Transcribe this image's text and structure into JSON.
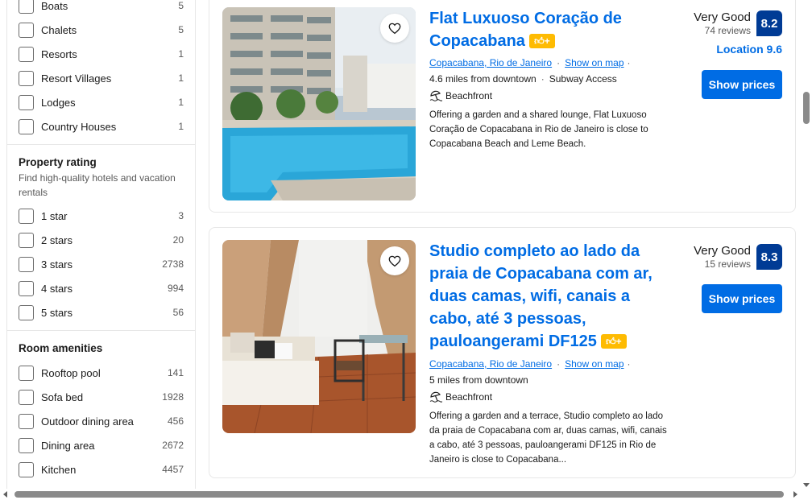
{
  "filters": {
    "property_type": [
      {
        "label": "Boats",
        "count": "5"
      },
      {
        "label": "Chalets",
        "count": "5"
      },
      {
        "label": "Resorts",
        "count": "1"
      },
      {
        "label": "Resort Villages",
        "count": "1"
      },
      {
        "label": "Lodges",
        "count": "1"
      },
      {
        "label": "Country Houses",
        "count": "1"
      }
    ],
    "property_rating": {
      "heading": "Property rating",
      "subtitle": "Find high-quality hotels and vacation rentals",
      "items": [
        {
          "label": "1 star",
          "count": "3"
        },
        {
          "label": "2 stars",
          "count": "20"
        },
        {
          "label": "3 stars",
          "count": "2738"
        },
        {
          "label": "4 stars",
          "count": "994"
        },
        {
          "label": "5 stars",
          "count": "56"
        }
      ]
    },
    "room_amenities": {
      "heading": "Room amenities",
      "items": [
        {
          "label": "Rooftop pool",
          "count": "141"
        },
        {
          "label": "Sofa bed",
          "count": "1928"
        },
        {
          "label": "Outdoor dining area",
          "count": "456"
        },
        {
          "label": "Dining area",
          "count": "2672"
        },
        {
          "label": "Kitchen",
          "count": "4457"
        }
      ]
    }
  },
  "listings": [
    {
      "title": "Flat Luxuoso Coração de Copacabana",
      "location": "Copacabana, Rio de Janeiro",
      "show_on_map": "Show on map",
      "distance": "4.6 miles from downtown",
      "transit": "Subway Access",
      "amenity": "Beachfront",
      "description": "Offering a garden and a shared lounge, Flat Luxuoso Coração de Copacabana in Rio de Janeiro is close to Copacabana Beach and Leme Beach.",
      "review_word": "Very Good",
      "review_count": "74 reviews",
      "score": "8.2",
      "location_score": "Location 9.6",
      "button": "Show prices"
    },
    {
      "title": "Studio completo ao lado da praia de Copacabana com ar, duas camas, wifi, canais a cabo, até 3 pessoas, pauloangerami DF125",
      "location": "Copacabana, Rio de Janeiro",
      "show_on_map": "Show on map",
      "distance": "5 miles from downtown",
      "amenity": "Beachfront",
      "description": "Offering a garden and a terrace, Studio completo ao lado da praia de Copacabana com ar, duas camas, wifi, canais a cabo, até 3 pessoas, pauloangerami DF125 in Rio de Janeiro is close to Copacabana...",
      "review_word": "Very Good",
      "review_count": "15 reviews",
      "score": "8.3",
      "button": "Show prices"
    }
  ],
  "colors": {
    "link_blue": "#006ce4",
    "score_navy": "#003b95",
    "badge_yellow": "#febb02"
  },
  "icons": {
    "favorite": "heart-icon",
    "beach": "beach-umbrella-icon",
    "preferred": "thumbs-up-plus-badge-icon"
  }
}
